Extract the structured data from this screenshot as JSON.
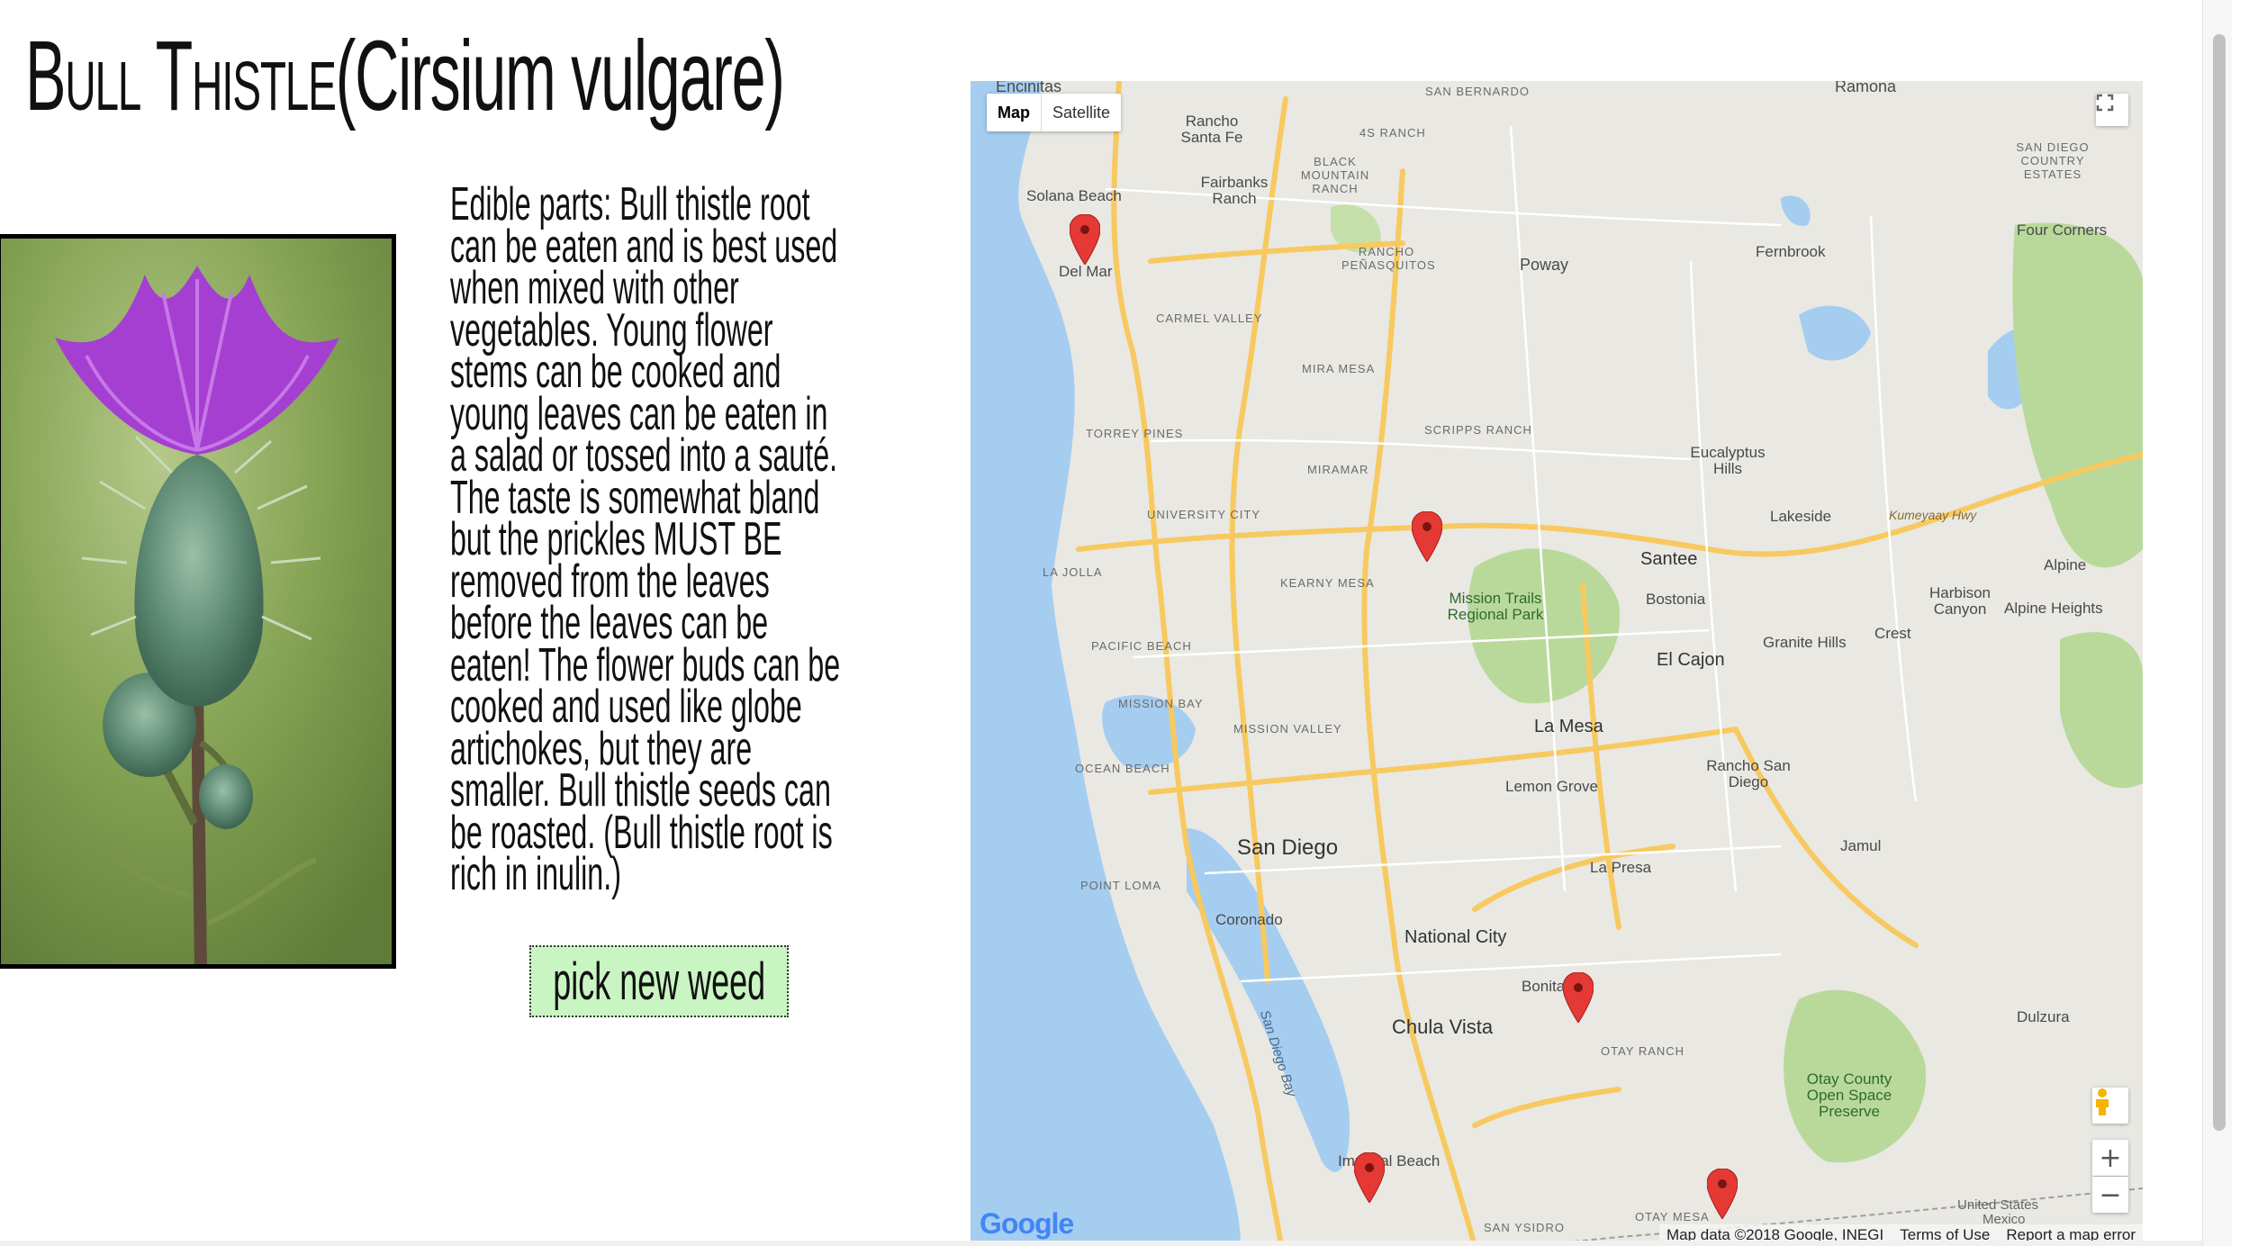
{
  "page": {
    "title_common": "Bull Thistle",
    "title_latin": "(Cirsium vulgare)",
    "description": "Edible parts: Bull thistle root\ncan be eaten and is best used\nwhen mixed with other\nvegetables. Young flower\nstems can be cooked and\nyoung leaves can be eaten in\na salad or tossed into a sauté.\nThe taste is somewhat bland\nbut the prickles MUST BE\nremoved from the leaves\nbefore the leaves can be\neaten! The flower buds can be\ncooked and used like globe\nartichokes, but they are\nsmaller. Bull thistle seeds can\nbe roasted. (Bull thistle root is\nrich in inulin.)",
    "button_label": "pick new weed"
  },
  "map": {
    "type_map": "Map",
    "type_satellite": "Satellite",
    "attribution": "Map data ©2018 Google, INEGI",
    "terms": "Terms of Use",
    "report": "Report a map error",
    "logo": "Google",
    "zoom_in": "+",
    "zoom_out": "−",
    "labels": {
      "encinitas": "Encinitas",
      "ramona": "Ramona",
      "san_bernardo": "SAN BERNARDO",
      "rancho_santa_fe": "Rancho Santa Fe",
      "four_s_ranch": "4S RANCH",
      "solana_beach": "Solana Beach",
      "fairbanks_ranch": "Fairbanks Ranch",
      "black_mountain_ranch": "BLACK MOUNTAIN RANCH",
      "del_mar": "Del Mar",
      "rancho_penasquitos": "RANCHO PEÑASQUITOS",
      "poway": "Poway",
      "fernbrook": "Fernbrook",
      "san_diego_country_estates": "SAN DIEGO COUNTRY ESTATES",
      "four_corners": "Four Corners",
      "carmel_valley": "CARMEL VALLEY",
      "mira_mesa": "MIRA MESA",
      "torrey_pines": "TORREY PINES",
      "scripps_ranch": "SCRIPPS RANCH",
      "miramar": "MIRAMAR",
      "eucalyptus_hills": "Eucalyptus Hills",
      "university_city": "UNIVERSITY CITY",
      "lakeside": "Lakeside",
      "kumeyaay_hwy": "Kumeyaay Hwy",
      "santee": "Santee",
      "alpine": "Alpine",
      "la_jolla": "LA JOLLA",
      "kearny_mesa": "KEARNY MESA",
      "mission_trails": "Mission Trails Regional Park",
      "bostonia": "Bostonia",
      "harbison_canyon": "Harbison Canyon",
      "alpine_heights": "Alpine Heights",
      "pacific_beach": "PACIFIC BEACH",
      "granite_hills": "Granite Hills",
      "crest": "Crest",
      "el_cajon": "El Cajon",
      "mission_bay": "MISSION BAY",
      "mission_valley": "MISSION VALLEY",
      "la_mesa": "La Mesa",
      "ocean_beach": "OCEAN BEACH",
      "rancho_san_diego": "Rancho San Diego",
      "lemon_grove": "Lemon Grove",
      "san_diego": "San Diego",
      "jamul": "Jamul",
      "point_loma": "POINT LOMA",
      "la_presa": "La Presa",
      "coronado": "Coronado",
      "national_city": "National City",
      "bonita": "Bonita",
      "san_diego_bay": "San Diego Bay",
      "chula_vista": "Chula Vista",
      "otay_ranch": "OTAY RANCH",
      "dulzura": "Dulzura",
      "otay_county": "Otay County Open Space Preserve",
      "imperial_beach": "Imperial Beach",
      "otay_mesa": "OTAY MESA",
      "san_ysidro": "SAN YSIDRO",
      "united_states": "United States",
      "mexico": "Mexico"
    }
  },
  "colors": {
    "button_bg": "#c9f5c3",
    "marker": "#e53935",
    "water": "#a5cdf0",
    "park": "#b9d99b",
    "highway": "#f7c95f"
  }
}
